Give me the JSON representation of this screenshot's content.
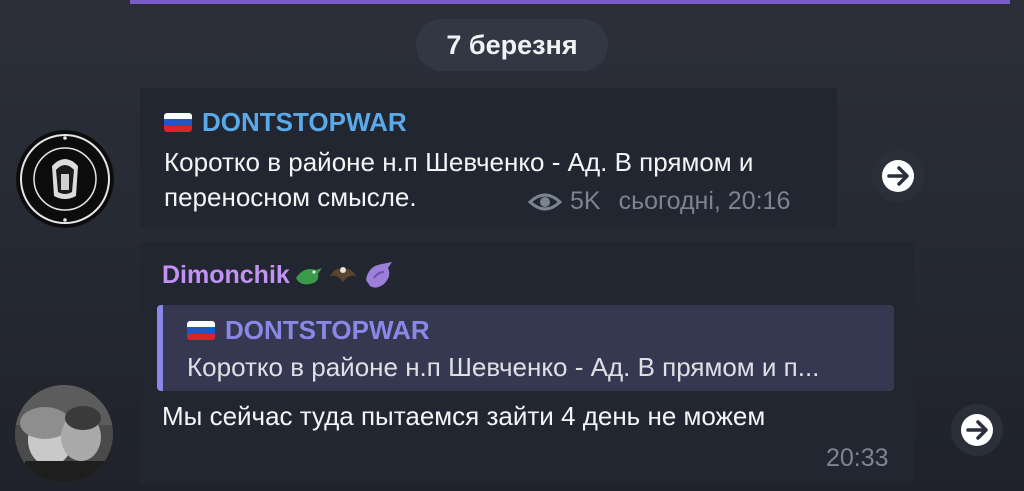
{
  "date_separator": "7 березня",
  "message1": {
    "channel": "DONTSTOPWAR",
    "text_line1": "Коротко в районе н.п Шевченко - Ад. В прямом и",
    "text_line2": "переносном смысле.",
    "views": "5K",
    "time": "сьогодні, 20:16"
  },
  "message2": {
    "author": "Dimonchik",
    "reply": {
      "channel": "DONTSTOPWAR",
      "text": "Коротко в районе н.п Шевченко - Ад. В прямом и п..."
    },
    "text": "Мы сейчас туда пытаемся зайти 4 день не можем",
    "time": "20:33"
  },
  "colors": {
    "channel_name": "#5aa9e8",
    "author_name": "#c293f5",
    "reply_accent": "#8a88e6",
    "bubble": "#212630"
  },
  "icons": {
    "flag": "russia-flag-icon",
    "views": "eye-icon",
    "forward": "share-arrow-icon"
  }
}
